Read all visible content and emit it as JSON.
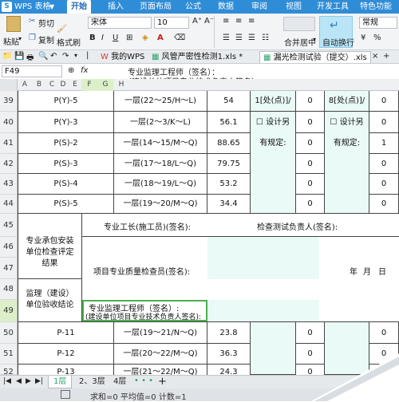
{
  "app": {
    "name": "WPS 表格"
  },
  "menu_tabs": [
    "开始",
    "插入",
    "页面布局",
    "公式",
    "数据",
    "审阅",
    "视图",
    "开发工具",
    "特色功能"
  ],
  "ribbon": {
    "paste": "粘贴",
    "cut": "剪切",
    "copy": "复制",
    "format_painter": "格式刷",
    "font_name": "宋体",
    "font_size": "10",
    "bold": "B",
    "italic": "I",
    "underline": "U",
    "merge_center": "合并居中",
    "wrap_text": "自动换行",
    "number_format": "常规",
    "currency": "¥"
  },
  "doc_tabs": [
    {
      "label": "我的WPS",
      "active": false
    },
    {
      "label": "风管严密性检测1.xls *",
      "active": false
    },
    {
      "label": "漏光检测试验（提交）.xls",
      "active": true
    }
  ],
  "formula_bar": {
    "cell_ref": "F49",
    "fx": "fx",
    "content_line1": "专业监理工程师（签名）：",
    "content_line2": "（建设单位项目专业技术负责人签名）："
  },
  "columns": [
    "A",
    "B",
    "C",
    "D",
    "E",
    "F",
    "G",
    "H",
    "I",
    "J",
    "K",
    "L",
    "M",
    "N",
    "O",
    "P",
    "Q"
  ],
  "rows": [
    {
      "num": "39",
      "c1": "P(Y)-5",
      "c2": "一层(22～25/H～L)",
      "c3": "54",
      "c4": "1[处(点)]/",
      "c5": "0",
      "c6": "8[处(点)]/",
      "c7": "0"
    },
    {
      "num": "40",
      "c1": "P(Y)-3",
      "c2": "一层(2～3/K～L)",
      "c3": "56.1",
      "c4": "☐ 设计另",
      "c5": "0",
      "c6": "☐ 设计另",
      "c7": "0"
    },
    {
      "num": "41",
      "c1": "P(S)-2",
      "c2": "一层(14～15/M～Q)",
      "c3": "88.65",
      "c4": "有规定:",
      "c5": "0",
      "c6": "有规定:",
      "c7": "1"
    },
    {
      "num": "42",
      "c1": "P(S)-3",
      "c2": "一层(17～18/L～Q)",
      "c3": "79.75",
      "c4": "",
      "c5": "0",
      "c6": "",
      "c7": "0"
    },
    {
      "num": "43",
      "c1": "P(S)-4",
      "c2": "一层(18～19/L～Q)",
      "c3": "53.2",
      "c4": "",
      "c5": "0",
      "c6": "",
      "c7": "0"
    },
    {
      "num": "44",
      "c1": "P(S)-5",
      "c2": "一层(19～20/M～Q)",
      "c3": "34.4",
      "c4": "",
      "c5": "0",
      "c6": "",
      "c7": "0"
    }
  ],
  "sign_block": {
    "n45": "45",
    "n46": "46",
    "n47": "47",
    "n48": "48",
    "n49": "49",
    "contractor_label": "专业承包安装单位检查评定结果",
    "foreman": "专业工长(施工员)(签名):",
    "tester": "检查测试负责人(签名):",
    "quality": "项目专业质量检查员(签名):",
    "year": "年",
    "month": "月",
    "day": "日",
    "supervisor_label": "监理（建设）单位验收结论",
    "engineer_line1": "专业监理工程师（签名）:",
    "engineer_line2": "(建设单位项目专业技术负责人签名):"
  },
  "rows_bottom": [
    {
      "num": "50",
      "c1": "P-11",
      "c2": "一层(19～21/N～Q)",
      "c3": "23.8",
      "c5": "0",
      "c7": "0"
    },
    {
      "num": "51",
      "c1": "P-12",
      "c2": "一层(20～22/M～Q)",
      "c3": "36.3",
      "c5": "0",
      "c7": "0"
    },
    {
      "num": "52",
      "c1": "P-13",
      "c2": "一层(21～22/M～Q)",
      "c3": "24.3",
      "c5": "0",
      "c7": "0"
    }
  ],
  "sheet_tabs": [
    {
      "label": "1层",
      "active": true
    },
    {
      "label": "2、3层",
      "active": false
    },
    {
      "label": "4层",
      "active": false
    }
  ],
  "sheet_more": "• • •",
  "sheet_add": "+",
  "status": {
    "text": "求和=0  平均值=0  计数=1"
  }
}
